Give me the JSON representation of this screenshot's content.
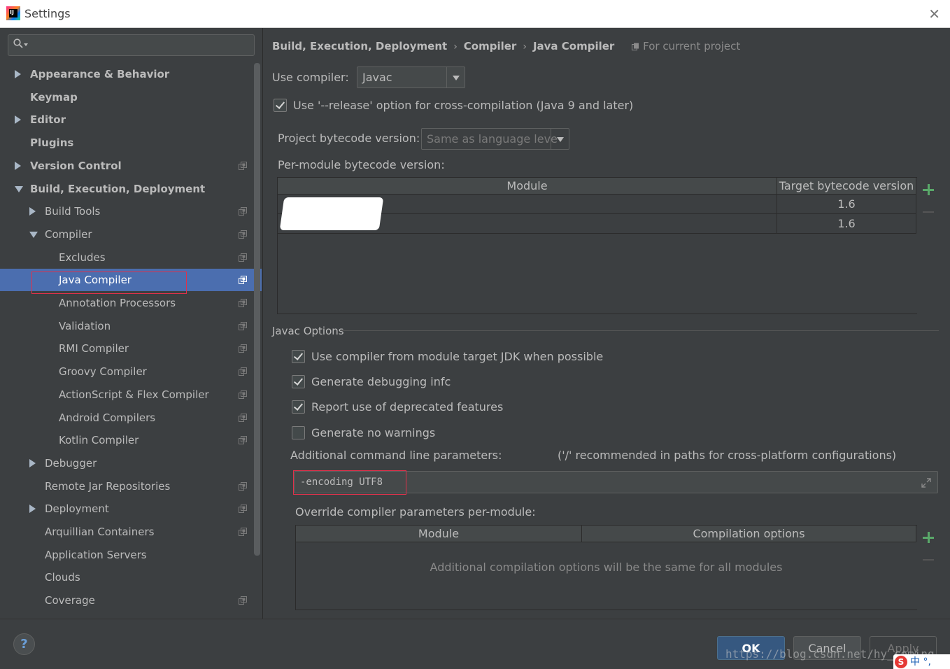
{
  "window": {
    "title": "Settings",
    "app_icon": "intellij-icon"
  },
  "sidebar": {
    "search_placeholder": "",
    "items": [
      {
        "label": "Appearance & Behavior",
        "level": 0,
        "arrow": "right",
        "bold": true,
        "project_icon": false
      },
      {
        "label": "Keymap",
        "level": 0,
        "arrow": "none",
        "bold": true,
        "project_icon": false
      },
      {
        "label": "Editor",
        "level": 0,
        "arrow": "right",
        "bold": true,
        "project_icon": false
      },
      {
        "label": "Plugins",
        "level": 0,
        "arrow": "none",
        "bold": true,
        "project_icon": false
      },
      {
        "label": "Version Control",
        "level": 0,
        "arrow": "right",
        "bold": true,
        "project_icon": true
      },
      {
        "label": "Build, Execution, Deployment",
        "level": 0,
        "arrow": "down",
        "bold": true,
        "project_icon": false
      },
      {
        "label": "Build Tools",
        "level": 1,
        "arrow": "right",
        "bold": false,
        "project_icon": true
      },
      {
        "label": "Compiler",
        "level": 1,
        "arrow": "down",
        "bold": false,
        "project_icon": true
      },
      {
        "label": "Excludes",
        "level": 2,
        "arrow": "none",
        "bold": false,
        "project_icon": true
      },
      {
        "label": "Java Compiler",
        "level": 2,
        "arrow": "none",
        "bold": false,
        "project_icon": true,
        "selected": true
      },
      {
        "label": "Annotation Processors",
        "level": 2,
        "arrow": "none",
        "bold": false,
        "project_icon": true
      },
      {
        "label": "Validation",
        "level": 2,
        "arrow": "none",
        "bold": false,
        "project_icon": true
      },
      {
        "label": "RMI Compiler",
        "level": 2,
        "arrow": "none",
        "bold": false,
        "project_icon": true
      },
      {
        "label": "Groovy Compiler",
        "level": 2,
        "arrow": "none",
        "bold": false,
        "project_icon": true
      },
      {
        "label": "ActionScript & Flex Compiler",
        "level": 2,
        "arrow": "none",
        "bold": false,
        "project_icon": true
      },
      {
        "label": "Android Compilers",
        "level": 2,
        "arrow": "none",
        "bold": false,
        "project_icon": true
      },
      {
        "label": "Kotlin Compiler",
        "level": 2,
        "arrow": "none",
        "bold": false,
        "project_icon": true
      },
      {
        "label": "Debugger",
        "level": 1,
        "arrow": "right",
        "bold": false,
        "project_icon": false
      },
      {
        "label": "Remote Jar Repositories",
        "level": 1,
        "arrow": "none",
        "bold": false,
        "project_icon": true
      },
      {
        "label": "Deployment",
        "level": 1,
        "arrow": "right",
        "bold": false,
        "project_icon": true
      },
      {
        "label": "Arquillian Containers",
        "level": 1,
        "arrow": "none",
        "bold": false,
        "project_icon": true
      },
      {
        "label": "Application Servers",
        "level": 1,
        "arrow": "none",
        "bold": false,
        "project_icon": false
      },
      {
        "label": "Clouds",
        "level": 1,
        "arrow": "none",
        "bold": false,
        "project_icon": false
      },
      {
        "label": "Coverage",
        "level": 1,
        "arrow": "none",
        "bold": false,
        "project_icon": true
      }
    ]
  },
  "breadcrumb": {
    "items": [
      "Build, Execution, Deployment",
      "Compiler",
      "Java Compiler"
    ],
    "separator": "›",
    "scope": "For current project"
  },
  "compiler": {
    "use_compiler_label": "Use compiler:",
    "use_compiler_value": "Javac",
    "release_option_label": "Use '--release' option for cross-compilation (Java 9 and later)",
    "release_option_checked": true,
    "project_bytecode_label": "Project bytecode version:",
    "project_bytecode_value": "Same as language leve",
    "per_module_label": "Per-module bytecode version:",
    "module_table": {
      "headers": [
        "Module",
        "Target bytecode version"
      ],
      "rows": [
        {
          "module": "",
          "version": "1.6"
        },
        {
          "module": "",
          "version": "1.6"
        }
      ]
    }
  },
  "javac_options": {
    "group_title": "Javac Options",
    "checkboxes": [
      {
        "label": "Use compiler from module target JDK when possible",
        "checked": true
      },
      {
        "label": "Generate debugging infc",
        "checked": true
      },
      {
        "label": "Report use of deprecated features",
        "checked": true
      },
      {
        "label": "Generate no warnings",
        "checked": false
      }
    ],
    "additional_params_label": "Additional command line parameters:",
    "additional_params_hint": "('/' recommended in paths for cross-platform configurations)",
    "additional_params_value": "-encoding UTF8",
    "override_label": "Override compiler parameters per-module:",
    "override_table": {
      "headers": [
        "Module",
        "Compilation options"
      ],
      "empty_text": "Additional compilation options will be the same for all modules"
    }
  },
  "footer": {
    "help_label": "?",
    "ok_label": "OK",
    "cancel_label": "Cancel",
    "apply_label": "Apply",
    "watermark": "https://blog.csdn.net/hy_coming",
    "ime_text": "中 °,"
  },
  "colors": {
    "background": "#3c3f41",
    "selection": "#4b6eaf",
    "accent_green": "#59a869",
    "highlight_red": "#e0314b"
  }
}
